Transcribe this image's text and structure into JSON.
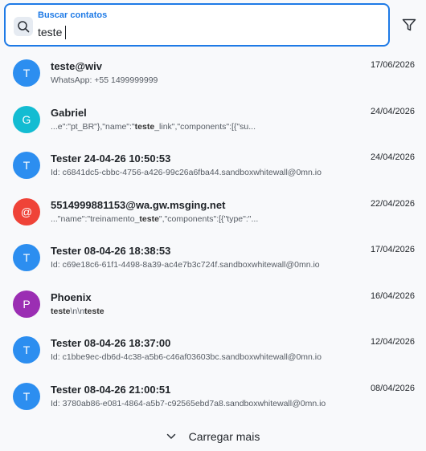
{
  "search": {
    "label": "Buscar contatos",
    "value": "teste"
  },
  "contacts": [
    {
      "initial": "T",
      "color": "#2c8ef0",
      "name": "teste@wiv",
      "sub": "WhatsApp: +55 1499999999",
      "date": "17/06/2026"
    },
    {
      "initial": "G",
      "color": "#13bcd2",
      "name": "Gabriel",
      "sub": "...e\":\"pt_BR\"},\"name\":\"teste_link\",\"components\":[{\"su...",
      "date": "24/04/2026"
    },
    {
      "initial": "T",
      "color": "#2c8ef0",
      "name": "Tester 24-04-26 10:50:53",
      "sub": "Id: c6841dc5-cbbc-4756-a426-99c26a6fba44.sandboxwhitewall@0mn.io",
      "date": "24/04/2026"
    },
    {
      "initial": "@",
      "color": "#ef4338",
      "name": "5514999881153@wa.gw.msging.net",
      "sub": "...\"name\":\"treinamento_teste\",\"components\":[{\"type\":\"...",
      "date": "22/04/2026"
    },
    {
      "initial": "T",
      "color": "#2c8ef0",
      "name": "Tester 08-04-26 18:38:53",
      "sub": "Id: c69e18c6-61f1-4498-8a39-ac4e7b3c724f.sandboxwhitewall@0mn.io",
      "date": "17/04/2026"
    },
    {
      "initial": "P",
      "color": "#9b2eb3",
      "name": "Phoenix",
      "sub": "teste\\n\\nteste",
      "date": "16/04/2026"
    },
    {
      "initial": "T",
      "color": "#2c8ef0",
      "name": "Tester 08-04-26 18:37:00",
      "sub": "Id: c1bbe9ec-db6d-4c38-a5b6-c46af03603bc.sandboxwhitewall@0mn.io",
      "date": "12/04/2026"
    },
    {
      "initial": "T",
      "color": "#2c8ef0",
      "name": "Tester 08-04-26 21:00:51",
      "sub": "Id: 3780ab86-e081-4864-a5b7-c92565ebd7a8.sandboxwhitewall@0mn.io",
      "date": "08/04/2026"
    }
  ],
  "load_more": {
    "label": "Carregar mais",
    "icon": "chevron-down-icon"
  },
  "icons": {
    "search": "search-icon",
    "filter": "filter-icon"
  },
  "colors": {
    "accent": "#1e7ae6"
  }
}
